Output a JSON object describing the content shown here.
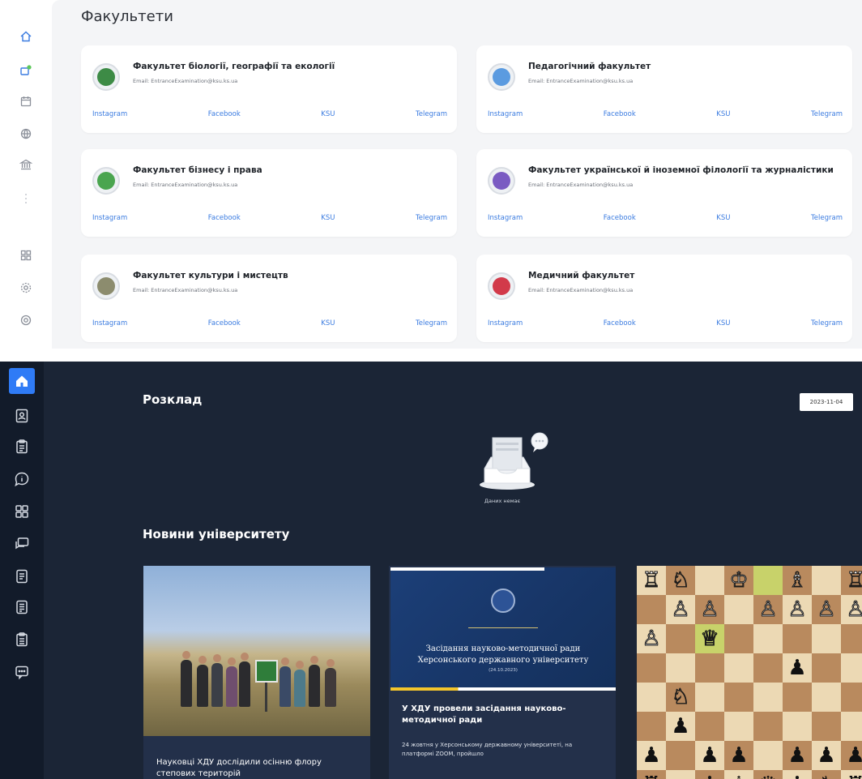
{
  "top": {
    "title": "Факультети",
    "link_labels": [
      "Instagram",
      "Facebook",
      "KSU",
      "Telegram"
    ],
    "faculties": [
      {
        "name": "Факультет біології, географії та екології",
        "email": "Email: EntranceExamination@ksu.ks.ua",
        "logo_color": "#3d8b46"
      },
      {
        "name": "Педагогічний факультет",
        "email": "Email: EntranceExamination@ksu.ks.ua",
        "logo_color": "#5b9be0"
      },
      {
        "name": "Факультет бізнесу і права",
        "email": "Email: EntranceExamination@ksu.ks.ua",
        "logo_color": "#4aa54f"
      },
      {
        "name": "Факультет української й іноземної філології та журналістики",
        "email": "Email: EntranceExamination@ksu.ks.ua",
        "logo_color": "#7a5bc2"
      },
      {
        "name": "Факультет культури і мистецтв",
        "email": "Email: EntranceExamination@ksu.ks.ua",
        "logo_color": "#8c8c6e"
      },
      {
        "name": "Медичний факультет",
        "email": "Email: EntranceExamination@ksu.ks.ua",
        "logo_color": "#d23a4a"
      }
    ],
    "sidebar_icons": [
      "home-icon",
      "notification-icon",
      "calendar-icon",
      "globe-icon",
      "institution-icon",
      "more-icon",
      "grid-icon",
      "settings-icon",
      "help-icon"
    ]
  },
  "bottom": {
    "schedule_title": "Розклад",
    "date": "2023-11-04",
    "empty_text": "Даних немає",
    "news_title": "Новини університету",
    "news": [
      {
        "text": "Науковці ХДУ дослідили осінню флору степових територій"
      },
      {
        "poster_title": "Засідання науково-методичної ради Херсонського державного університету",
        "poster_date": "(24.10.2023)",
        "title": "У ХДУ провели засідання науково-методичної ради",
        "body": "24 жовтня у Херсонському державному університеті, на платформі ZOOM, пройшло"
      }
    ],
    "sidebar_icons": [
      "home-icon",
      "contacts-icon",
      "clipboard-icon",
      "info-chat-icon",
      "apps-grid-icon",
      "chat-icon",
      "document-icon",
      "notes-icon",
      "list-icon",
      "message-icon"
    ],
    "accent_color": "#2f7bf6"
  }
}
